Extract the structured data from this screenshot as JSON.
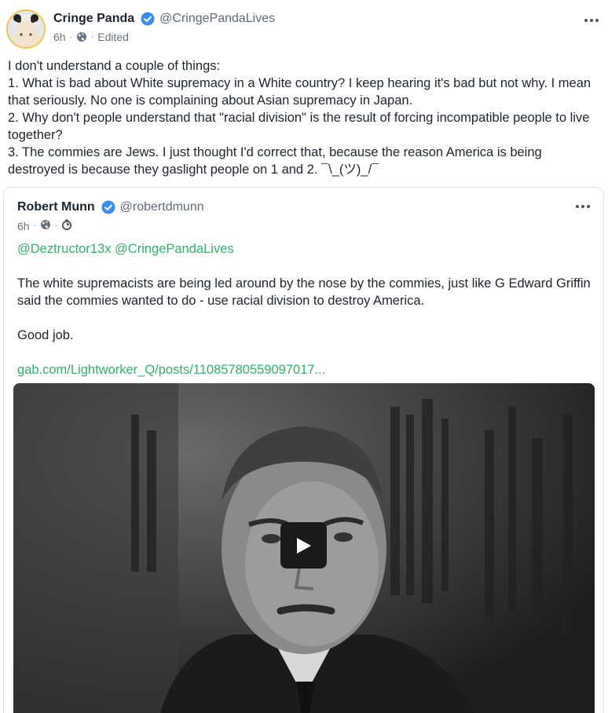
{
  "post": {
    "author_name": "Cringe Panda",
    "handle": "@CringePandaLives",
    "time": "6h",
    "edited_label": "Edited",
    "lines": [
      "I don't understand a couple of things:",
      "1. What is bad about White supremacy in a White country? I keep hearing it's bad but not why. I mean that seriously. No one is complaining about Asian supremacy in Japan.",
      "2. Why don't people understand that \"racial division\" is the result of forcing incompatible people to live together?",
      "3. The commies are Jews. I just thought I'd correct that, because the reason America is being destroyed is because they gaslight people on 1 and 2. ¯\\_(ツ)_/¯"
    ]
  },
  "quote": {
    "author_name": "Robert Munn",
    "handle": "@robertdmunn",
    "time": "6h",
    "mentions": "@Deztructor13x @CringePandaLives",
    "paragraph1": "The white supremacists are being led around by the nose by the commies, just like G Edward Griffin said the commies wanted to do - use racial division to destroy America.",
    "paragraph2": "Good job.",
    "link": "gab.com/Lightworker_Q/posts/11085780559097017..."
  },
  "icons": {
    "verified": "verified-badge-icon",
    "globe": "globe-icon",
    "timer": "timer-icon",
    "more": "more-options-icon",
    "play": "play-icon"
  },
  "colors": {
    "verified": "#3b8ded",
    "link": "#2fb36b",
    "avatar_border": "#f3c34a"
  }
}
